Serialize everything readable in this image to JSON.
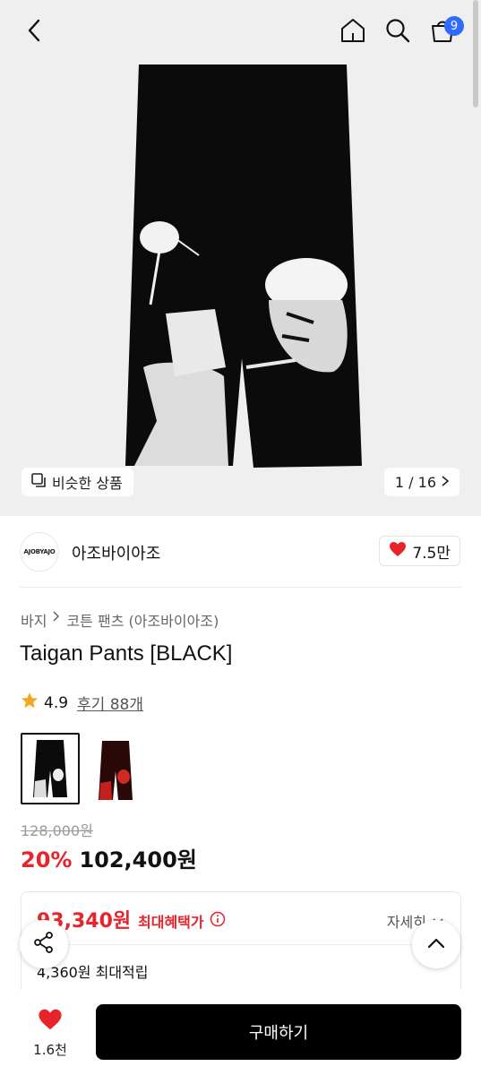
{
  "header": {
    "back_icon": "chevron-left-icon",
    "home_icon": "home-icon",
    "search_icon": "search-icon",
    "cart_icon": "shopping-bag-icon",
    "cart_count": "9"
  },
  "gallery": {
    "similar_label": "비슷한 상품",
    "page_indicator": "1 / 16"
  },
  "brand": {
    "logo_text": "AJOBYAJO",
    "name": "아조바이아조",
    "likes": "7.5만"
  },
  "product": {
    "breadcrumb": [
      "바지",
      "코튼 팬츠 (아조바이아조)"
    ],
    "title": "Taigan Pants [BLACK]",
    "rating": "4.9",
    "reviews": "후기 88개",
    "color_options": [
      "black",
      "red"
    ],
    "original_price": "128,000원",
    "discount": "20%",
    "sale_price": "102,400원"
  },
  "benefit": {
    "max_benefit_price": "93,340원",
    "max_benefit_label": "최대혜택가",
    "detail_label": "자세히",
    "max_points": "4,360원 최대적립"
  },
  "bottom": {
    "wish_count": "1.6천",
    "buy_label": "구매하기"
  },
  "colors": {
    "accent_red": "#e8242b",
    "badge_blue": "#2f6bff",
    "buy_button": "#000000"
  }
}
